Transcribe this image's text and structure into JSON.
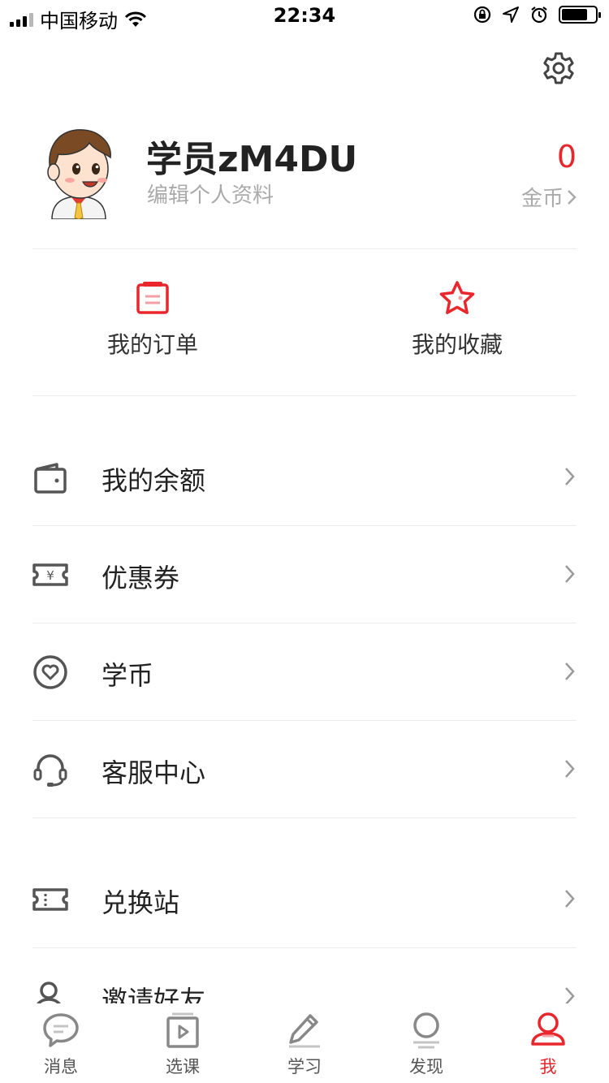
{
  "status_bar": {
    "carrier": "中国移动",
    "time": "22:34"
  },
  "profile": {
    "username": "学员zM4DU",
    "edit_label": "编辑个人资料",
    "coins_value": "0",
    "coins_label": "金币"
  },
  "quick_actions": [
    {
      "label": "我的订单",
      "icon": "clipboard-icon"
    },
    {
      "label": "我的收藏",
      "icon": "star-icon"
    }
  ],
  "menu": [
    {
      "label": "我的余额",
      "icon": "wallet-icon"
    },
    {
      "label": "优惠券",
      "icon": "coupon-icon"
    },
    {
      "label": "学币",
      "icon": "heart-coin-icon"
    },
    {
      "label": "客服中心",
      "icon": "headset-icon"
    },
    {
      "label": "兑换站",
      "icon": "ticket-icon"
    },
    {
      "label": "邀请好友",
      "icon": "person-icon"
    }
  ],
  "tab_bar": {
    "items": [
      {
        "label": "消息",
        "icon": "chat-bubble-icon"
      },
      {
        "label": "选课",
        "icon": "video-book-icon"
      },
      {
        "label": "学习",
        "icon": "pencil-icon"
      },
      {
        "label": "发现",
        "icon": "discover-icon"
      },
      {
        "label": "我",
        "icon": "profile-icon"
      }
    ],
    "active": "我"
  },
  "colors": {
    "accent": "#e8262c",
    "text": "#222222",
    "muted": "#aaaaaa",
    "icon": "#555555",
    "divider": "#ececec"
  }
}
